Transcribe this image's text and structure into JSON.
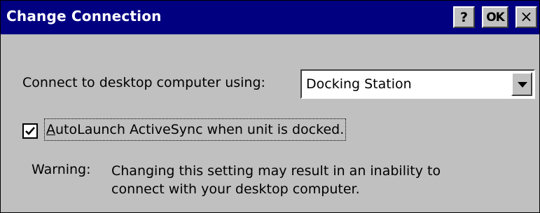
{
  "window": {
    "title": "Change Connection",
    "help_label": "?",
    "ok_label": "OK",
    "close_label": "×"
  },
  "connect": {
    "label": "Connect to desktop computer using:",
    "selected": "Docking Station"
  },
  "autolaunch": {
    "checked": true,
    "mnemonic": "A",
    "label_rest": "utoLaunch ActiveSync when unit is docked."
  },
  "warning": {
    "label": "Warning:",
    "line1": "Changing this setting may result in an inability to",
    "line2": "connect with your desktop computer."
  },
  "colors": {
    "titlebar": "#000080",
    "face": "#c0c0c0"
  }
}
